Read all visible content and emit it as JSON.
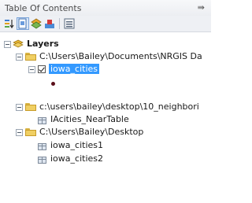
{
  "panel": {
    "title": "Table Of Contents",
    "pin_glyph": "⇛"
  },
  "toolbar": {
    "buttons": [
      {
        "icon": "list-by-drawing-order-icon",
        "active": false
      },
      {
        "icon": "list-by-source-icon",
        "active": true
      },
      {
        "icon": "list-by-visibility-icon",
        "active": false
      },
      {
        "icon": "list-by-selection-icon",
        "active": false
      },
      {
        "icon": "options-icon",
        "active": false
      }
    ]
  },
  "tree": {
    "root": {
      "label": "Layers"
    },
    "folders": [
      {
        "path": "C:\\Users\\Bailey\\Documents\\NRGIS Da",
        "items": [
          {
            "label": "iowa_cities",
            "checked": true,
            "selected": true
          }
        ]
      },
      {
        "path": "c:\\users\\bailey\\desktop\\10_neighbori",
        "items": [
          {
            "label": "IAcities_NearTable"
          }
        ]
      },
      {
        "path": "C:\\Users\\Bailey\\Desktop",
        "items": [
          {
            "label": "iowa_cities1"
          },
          {
            "label": "iowa_cities2"
          }
        ]
      }
    ]
  },
  "colors": {
    "selection": "#3399ff",
    "point_symbol": "#5a0f1a",
    "folder": "#f0cf63"
  }
}
